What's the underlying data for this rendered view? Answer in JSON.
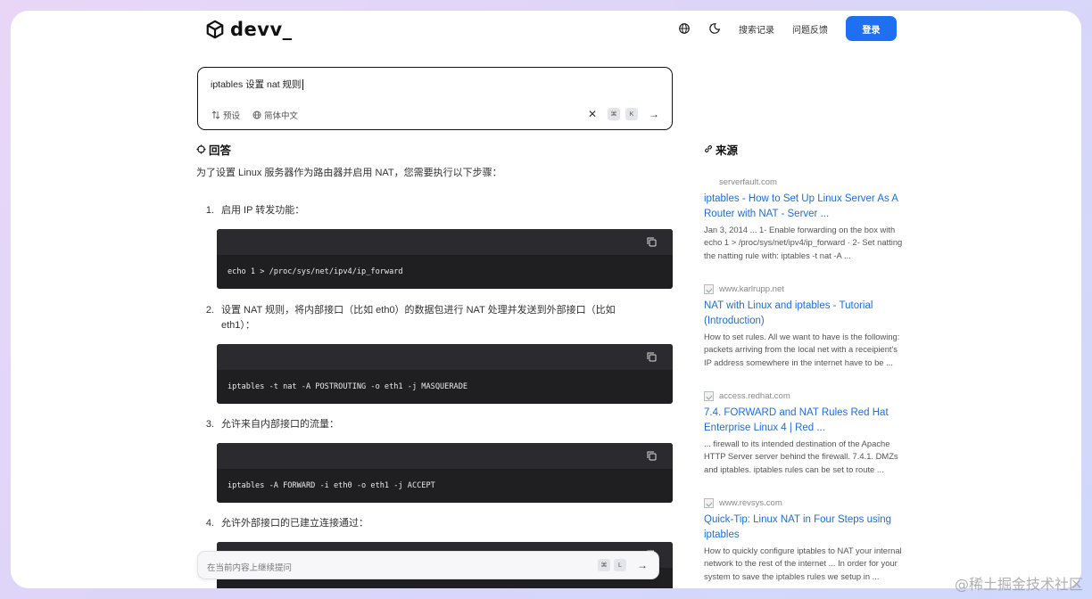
{
  "app": {
    "name": "devv_"
  },
  "header": {
    "history_label": "搜索记录",
    "feedback_label": "问题反馈",
    "login_label": "登录",
    "icons": [
      "globe-icon",
      "theme-toggle-icon"
    ]
  },
  "search": {
    "query": "iptables 设置 nat 规则",
    "preset_label": "预设",
    "language_label": "简体中文",
    "shortcut_keys": [
      "⌘",
      "K"
    ],
    "accent": "#111111"
  },
  "answer": {
    "title": "回答",
    "intro": "为了设置 Linux 服务器作为路由器并启用 NAT，您需要执行以下步骤：",
    "steps": [
      {
        "num": "1.",
        "text": "启用 IP 转发功能：",
        "code": "echo 1 > /proc/sys/net/ipv4/ip_forward"
      },
      {
        "num": "2.",
        "text": "设置 NAT 规则，将内部接口（比如 eth0）的数据包进行 NAT 处理并发送到外部接口（比如 eth1）：",
        "code": "iptables -t nat -A POSTROUTING -o eth1 -j MASQUERADE"
      },
      {
        "num": "3.",
        "text": "允许来自内部接口的流量：",
        "code": "iptables -A FORWARD -i eth0 -o eth1 -j ACCEPT"
      },
      {
        "num": "4.",
        "text": "允许外部接口的已建立连接通过：",
        "code": ""
      }
    ]
  },
  "sources": {
    "title": "来源",
    "items": [
      {
        "domain": "serverfault.com",
        "title": "iptables - How to Set Up Linux Server As A Router with NAT - Server ...",
        "snippet": "Jan 3, 2014 ... 1- Enable forwarding on the box with echo 1 > /proc/sys/net/ipv4/ip_forward · 2- Set natting the natting rule with: iptables -t nat -A ..."
      },
      {
        "domain": "www.karlrupp.net",
        "title": "NAT with Linux and iptables - Tutorial (Introduction)",
        "snippet": "How to set rules. All we want to have is the following: packets arriving from the local net with a receipient's IP address somewhere in the internet have to be ..."
      },
      {
        "domain": "access.redhat.com",
        "title": "7.4. FORWARD and NAT Rules Red Hat Enterprise Linux 4 | Red ...",
        "snippet": "... firewall to its intended destination of the Apache HTTP Server server behind the firewall. 7.4.1. DMZs and iptables. iptables rules can be set to route ..."
      },
      {
        "domain": "www.revsys.com",
        "title": "Quick-Tip: Linux NAT in Four Steps using iptables",
        "snippet": "How to quickly configure iptables to NAT your internal network to the rest of the internet ... In order for your system to save the iptables rules we setup in ..."
      }
    ]
  },
  "followup": {
    "placeholder": "在当前内容上继续提问",
    "shortcut_keys": [
      "⌘",
      "L"
    ]
  },
  "watermark": "@稀土掘金技术社区",
  "colors": {
    "primary": "#1e6ff2",
    "link": "#1d6fe0",
    "code_bg": "#1f1f22"
  }
}
